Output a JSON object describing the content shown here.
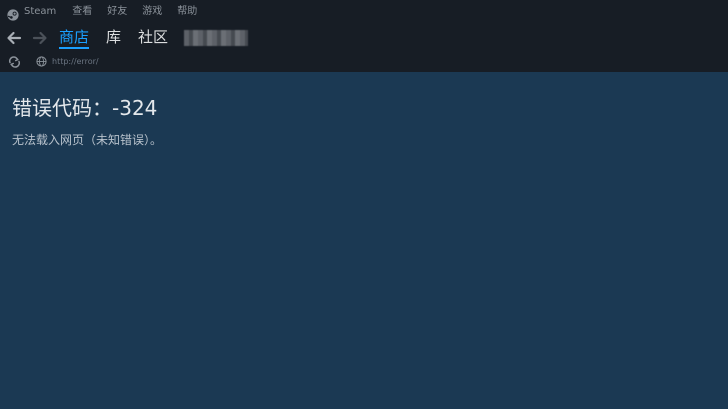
{
  "colors": {
    "topbar_bg": "#171d25",
    "content_bg": "#1b3953",
    "accent": "#1a9fff",
    "menu_text": "#8b929a",
    "nav_text": "#dcdedf"
  },
  "menubar": {
    "steam_label": "Steam",
    "items": [
      "查看",
      "好友",
      "游戏",
      "帮助"
    ]
  },
  "navbar": {
    "back_icon": "arrow-left-icon",
    "forward_icon": "arrow-right-icon",
    "tabs": [
      {
        "label": "商店",
        "active": true
      },
      {
        "label": "库",
        "active": false
      },
      {
        "label": "社区",
        "active": false
      }
    ]
  },
  "urlbar": {
    "reload_icon": "reload-icon",
    "globe_icon": "globe-icon",
    "url": "http://error/"
  },
  "error": {
    "title": "错误代码：-324",
    "message": "无法载入网页（未知错误）。"
  }
}
